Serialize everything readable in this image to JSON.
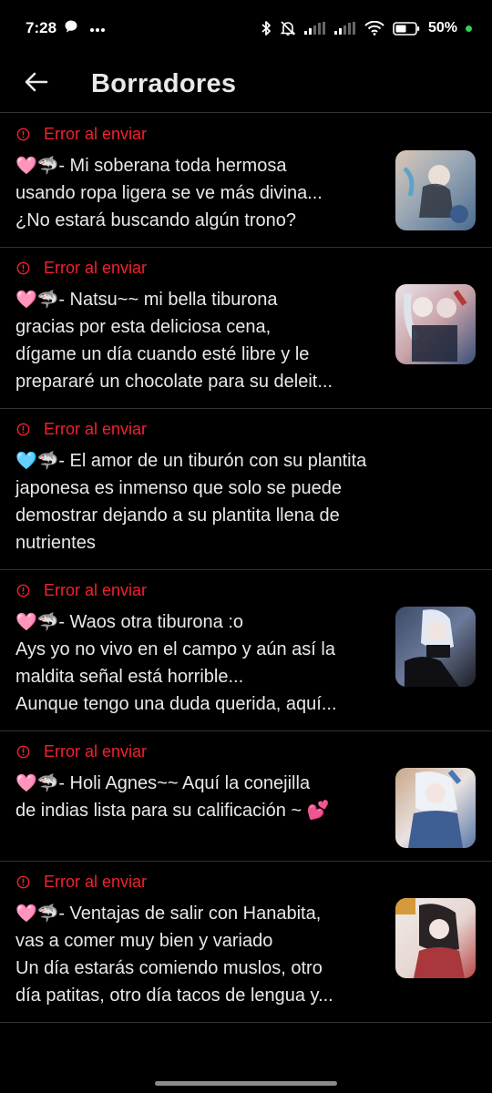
{
  "status_bar": {
    "time": "7:28",
    "battery": "50%",
    "icons": [
      "chat-bubble-icon",
      "more-dots-icon",
      "bluetooth-icon",
      "mute-bell-icon",
      "signal-icon",
      "signal-icon",
      "wifi-icon",
      "battery-icon"
    ]
  },
  "header": {
    "title": "Borradores",
    "back_icon": "arrow-left-icon"
  },
  "drafts": [
    {
      "error": "Error al enviar",
      "prefix_emoji": "🩷🦈",
      "text": "- Mi soberana toda hermosa\nusando ropa ligera se ve más divina...\n¿No estará buscando algún trono?",
      "has_thumb": true,
      "thumb_colors": [
        "#d9c7b6",
        "#4a6c8f",
        "#9aa7b5"
      ]
    },
    {
      "error": "Error al enviar",
      "prefix_emoji": "🩷🦈",
      "text": "- Natsu~~ mi bella tiburona\ngracias por esta deliciosa cena,\ndígame un día cuando esté libre y le\nprepararé un chocolate para su deleit...",
      "has_thumb": true,
      "thumb_colors": [
        "#e8e3ea",
        "#3b4f7a",
        "#c9a3a8"
      ]
    },
    {
      "error": "Error al enviar",
      "prefix_emoji": "🩵🦈",
      "text": "- El amor de un tiburón con su plantita\njaponesa es inmenso que solo se puede\ndemostrar dejando a su plantita llena de\nnutrientes",
      "has_thumb": false,
      "thumb_colors": []
    },
    {
      "error": "Error al enviar",
      "prefix_emoji": "🩷🦈",
      "text": "- Waos otra tiburona :o\nAys yo no vivo en el campo y aún así la\nmaldita señal está horrible...\nAunque tengo una duda querida, aquí...",
      "has_thumb": true,
      "thumb_colors": [
        "#3c4a66",
        "#d7d9e4",
        "#1d1d24"
      ]
    },
    {
      "error": "Error al enviar",
      "prefix_emoji": "🩷🦈",
      "text": "- Holi Agnes~~ Aquí la conejilla\nde indias lista para su calificación ~ 💕",
      "has_thumb": true,
      "thumb_colors": [
        "#c9a78a",
        "#e9e2e0",
        "#5a78a8"
      ]
    },
    {
      "error": "Error al enviar",
      "prefix_emoji": "🩷🦈",
      "text": "- Ventajas de salir con Hanabita,\nvas a comer muy bien y variado\nUn día estarás comiendo muslos, otro\ndía patitas, otro día tacos de lengua y...",
      "has_thumb": true,
      "thumb_colors": [
        "#f1ece8",
        "#2a2326",
        "#b84a4a"
      ]
    }
  ]
}
